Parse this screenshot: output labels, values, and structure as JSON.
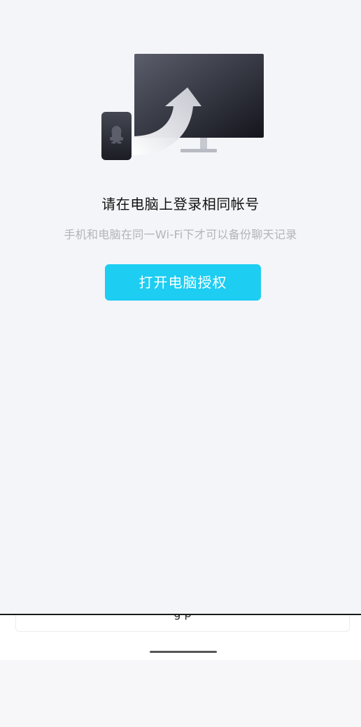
{
  "login_prompt": {
    "title": "请在电脑上登录相同帐号",
    "subtitle": "手机和电脑在同一Wi-Fi下才可以备份聊天记录",
    "button_label": "打开电脑授权"
  },
  "bottom_card": {
    "text": "g  p"
  },
  "colors": {
    "background": "#f4f5f9",
    "accent_button": "#1dcdf2",
    "subtitle_text": "#b3b3b8",
    "title_text": "#111111"
  },
  "icons": {
    "illustration": "phone-to-computer-transfer-icon",
    "phone_avatar": "qq-penguin-icon"
  }
}
